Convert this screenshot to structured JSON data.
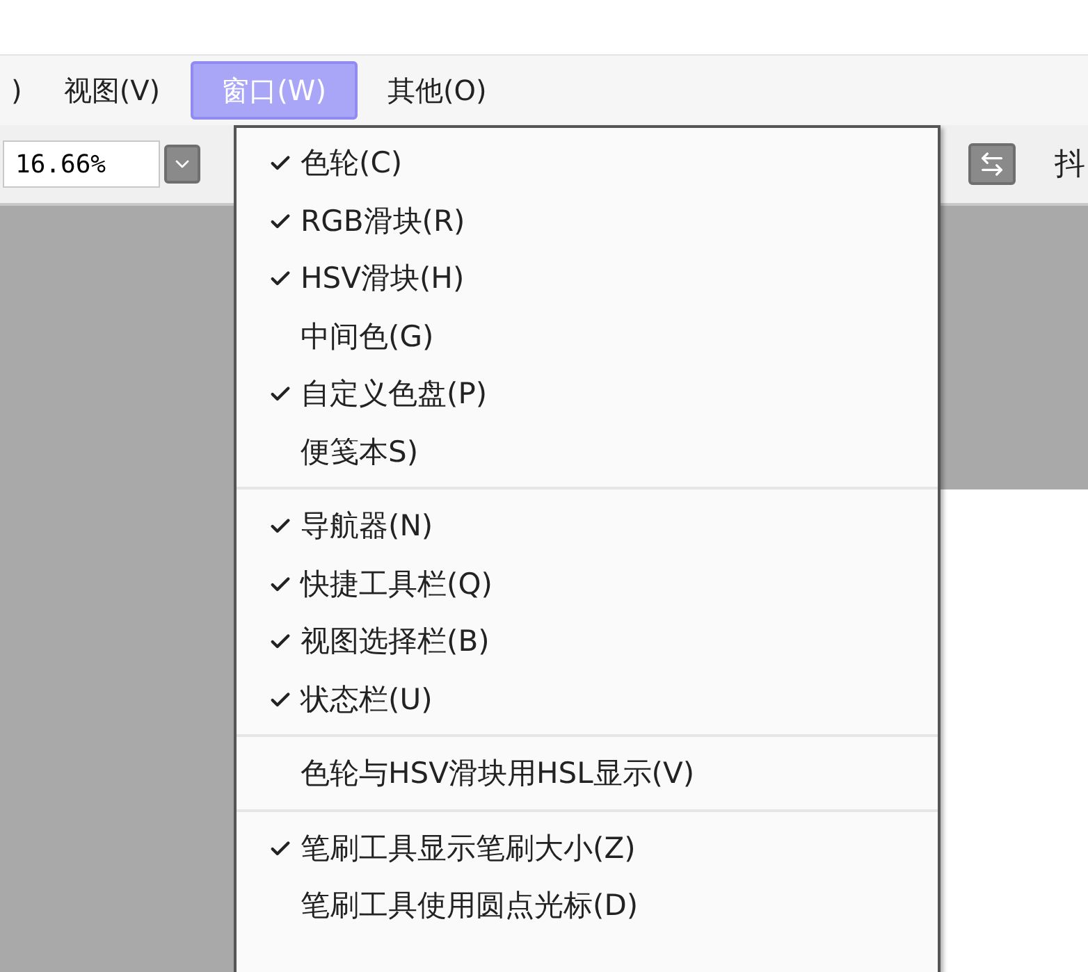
{
  "menu_bar": [
    {
      "label": ")",
      "selected": false
    },
    {
      "label": "视图(V)",
      "selected": false
    },
    {
      "label": "窗口(W)",
      "selected": true
    },
    {
      "label": "其他(O)",
      "selected": false
    }
  ],
  "toolbar": {
    "zoom_field": "16.66%",
    "trailing_text": "抖"
  },
  "window_menu": {
    "groups": [
      [
        {
          "label": "色轮(C)",
          "checked": true
        },
        {
          "label": "RGB滑块(R)",
          "checked": true
        },
        {
          "label": "HSV滑块(H)",
          "checked": true
        },
        {
          "label": "中间色(G)",
          "checked": false
        },
        {
          "label": "自定义色盘(P)",
          "checked": true
        },
        {
          "label": "便笺本S)",
          "checked": false
        }
      ],
      [
        {
          "label": "导航器(N)",
          "checked": true
        },
        {
          "label": "快捷工具栏(Q)",
          "checked": true
        },
        {
          "label": "视图选择栏(B)",
          "checked": true
        },
        {
          "label": "状态栏(U)",
          "checked": true
        }
      ],
      [
        {
          "label": "色轮与HSV滑块用HSL显示(V)",
          "checked": false
        }
      ],
      [
        {
          "label": "笔刷工具显示笔刷大小(Z)",
          "checked": true
        },
        {
          "label": "笔刷工具使用圆点光标(D)",
          "checked": false
        }
      ]
    ]
  }
}
